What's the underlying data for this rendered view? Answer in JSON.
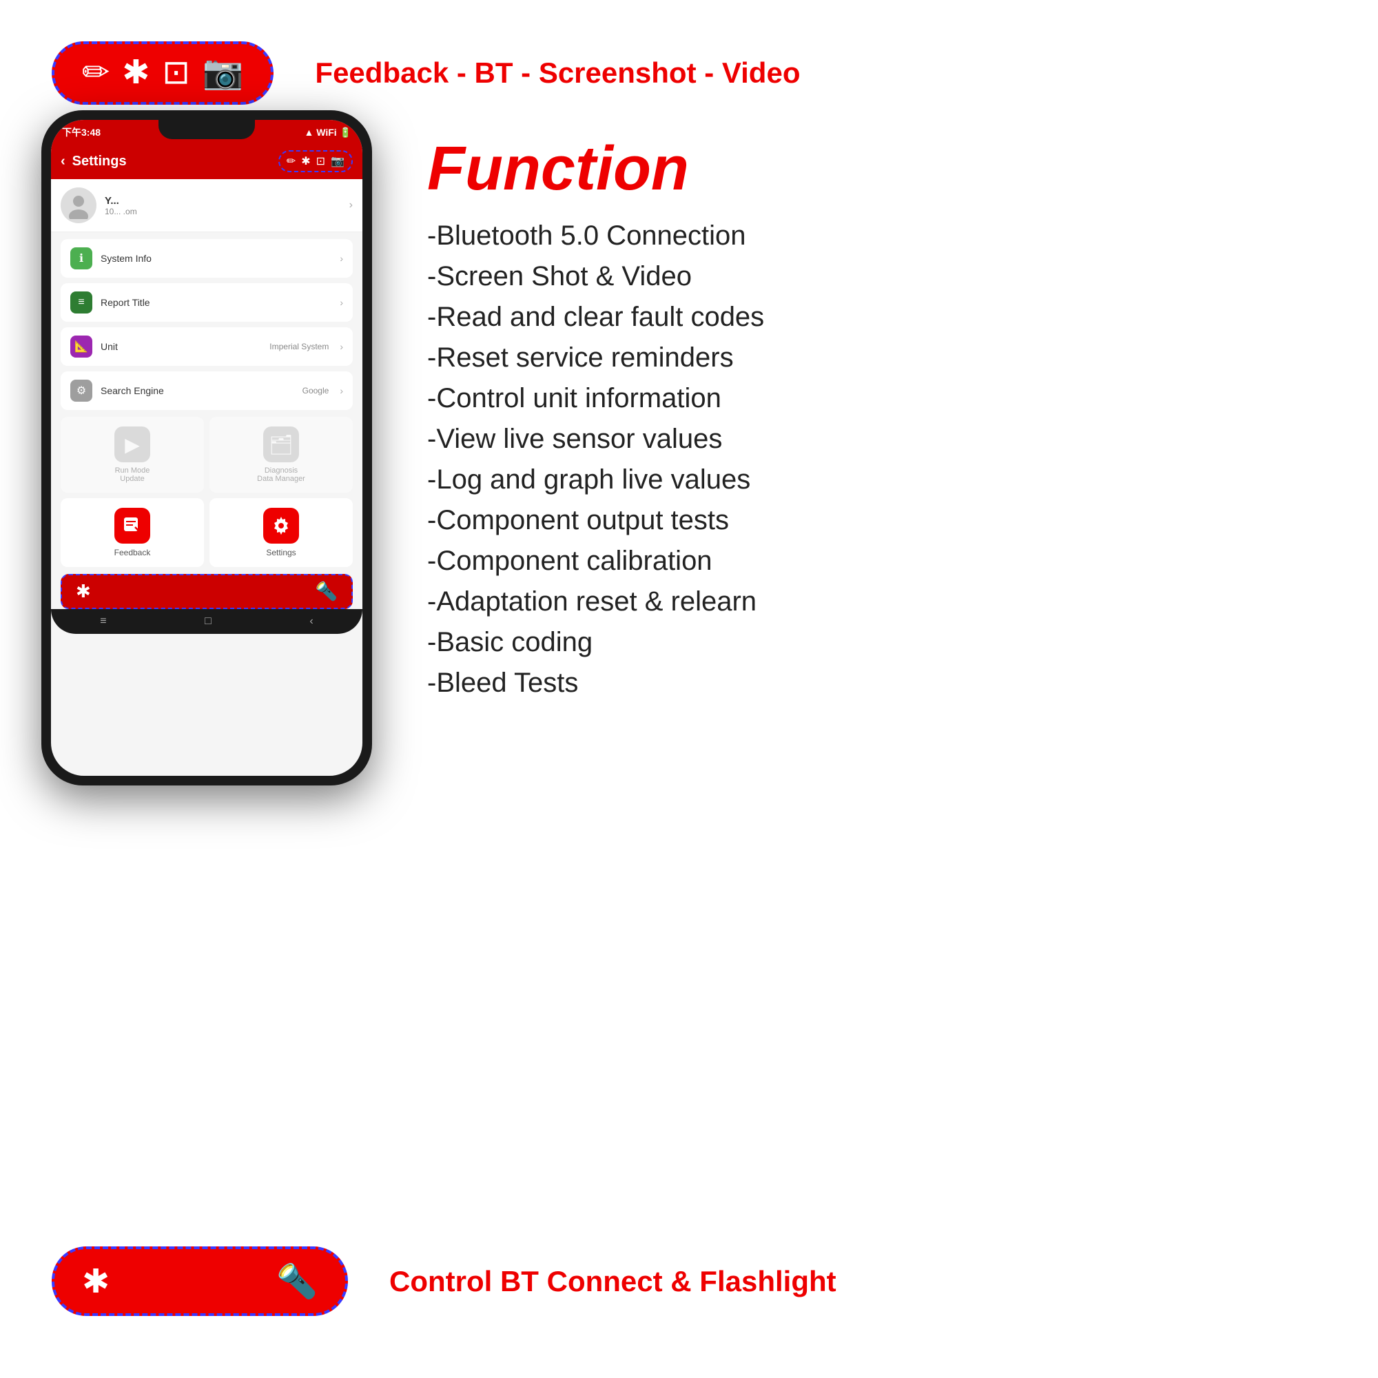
{
  "colors": {
    "red": "#e00000",
    "blue": "#3a3aff",
    "dark": "#1a1a1a"
  },
  "top_toolbar": {
    "label": "Feedback - BT - Screenshot - Video",
    "icons": [
      "✏️",
      "✱",
      "⊡",
      "🎥"
    ]
  },
  "bottom_toolbar": {
    "label": "Control BT Connect & Flashlight"
  },
  "phone": {
    "status_time": "下午3:48",
    "header_title": "Settings",
    "profile_initial": "👤",
    "profile_name": "Y...",
    "profile_email": "10...     .om",
    "settings": [
      {
        "icon": "ℹ",
        "icon_color": "green",
        "label": "System Info",
        "value": ""
      },
      {
        "icon": "📋",
        "icon_color": "green2",
        "label": "Report Title",
        "value": ""
      },
      {
        "icon": "📐",
        "icon_color": "purple",
        "label": "Unit",
        "value": "Imperial System"
      },
      {
        "icon": "🔍",
        "icon_color": "gray",
        "label": "Search Engine",
        "value": "Google"
      }
    ],
    "tiles": [
      {
        "label": "Run Mode\nUpdate",
        "dimmed": true
      },
      {
        "label": "Diagnosis\nData Manager",
        "dimmed": true
      },
      {
        "label": "Feedback",
        "dimmed": false
      },
      {
        "label": "Settings",
        "dimmed": false
      }
    ]
  },
  "function_title": "Function",
  "features": [
    "-Bluetooth 5.0 Connection",
    "-Screen Shot & Video",
    "-Read and clear fault codes",
    "-Reset service reminders",
    "-Control unit information",
    "-View live sensor values",
    "-Log and graph live values",
    "-Component output tests",
    "-Component calibration",
    "-Adaptation reset & relearn",
    "-Basic coding",
    "-Bleed Tests"
  ]
}
